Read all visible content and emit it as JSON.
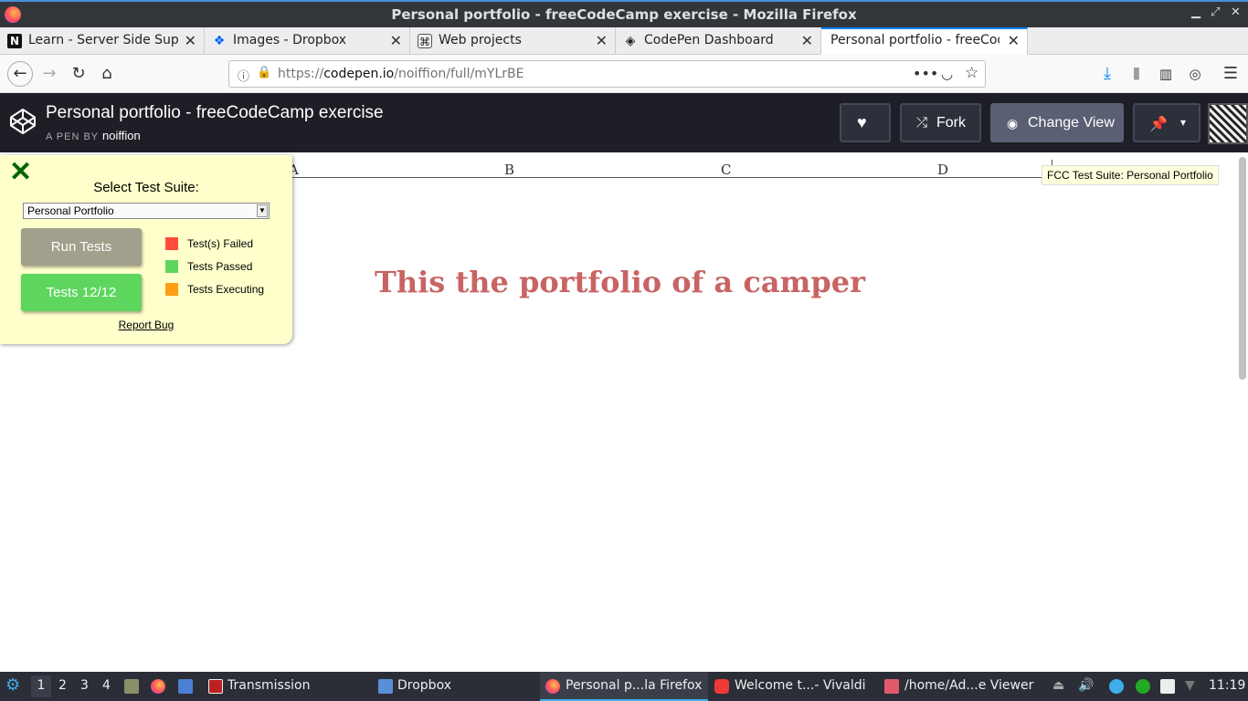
{
  "window": {
    "title": "Personal portfolio - freeCodeCamp exercise - Mozilla Firefox"
  },
  "tabs": [
    {
      "label": "Learn - Server Side Suppo",
      "icon": "notion-icon"
    },
    {
      "label": "Images - Dropbox",
      "icon": "dropbox-icon"
    },
    {
      "label": "Web projects",
      "icon": "web-icon"
    },
    {
      "label": "CodePen Dashboard",
      "icon": "codepen-icon"
    },
    {
      "label": "Personal portfolio - freeCode",
      "icon": "none",
      "active": true
    }
  ],
  "navbar": {
    "url_prefix": "https://",
    "url_domain": "codepen.io",
    "url_path": "/noiffion/full/mYLrBE"
  },
  "codepen": {
    "pen_title": "Personal portfolio - freeCodeCamp exercise",
    "pen_by": "A PEN BY",
    "author": "noiffion",
    "fork_label": "Fork",
    "change_view_label": "Change View"
  },
  "page": {
    "nav_letters": [
      "A",
      "B",
      "C",
      "D"
    ],
    "heading": "This the portfolio of a camper",
    "tooltip": "FCC Test Suite: Personal Portfolio"
  },
  "fcc_panel": {
    "close": "✕",
    "title": "Select Test Suite:",
    "selected_suite": "Personal Portfolio",
    "run_tests": "Run Tests",
    "tests_result": "Tests 12/12",
    "legend": [
      {
        "label": "Test(s) Failed",
        "color": "#ff4c3b"
      },
      {
        "label": "Tests Passed",
        "color": "#5ed65e"
      },
      {
        "label": "Tests Executing",
        "color": "#ff9d14"
      }
    ],
    "report_bug": "Report Bug"
  },
  "taskbar": {
    "workspaces": [
      "1",
      "2",
      "3",
      "4"
    ],
    "apps": [
      {
        "label": "Transmission"
      },
      {
        "label": "Dropbox"
      },
      {
        "label": "Personal p...la Firefox"
      },
      {
        "label": "Welcome t...- Vivaldi"
      },
      {
        "label": "/home/Ad...e Viewer"
      }
    ],
    "clock": "11:19"
  },
  "colors": {
    "heading": "#c86464",
    "codepen_header": "#1e1f26",
    "fcc_panel_bg": "#ffffcc",
    "passed_green": "#5ed65e"
  }
}
